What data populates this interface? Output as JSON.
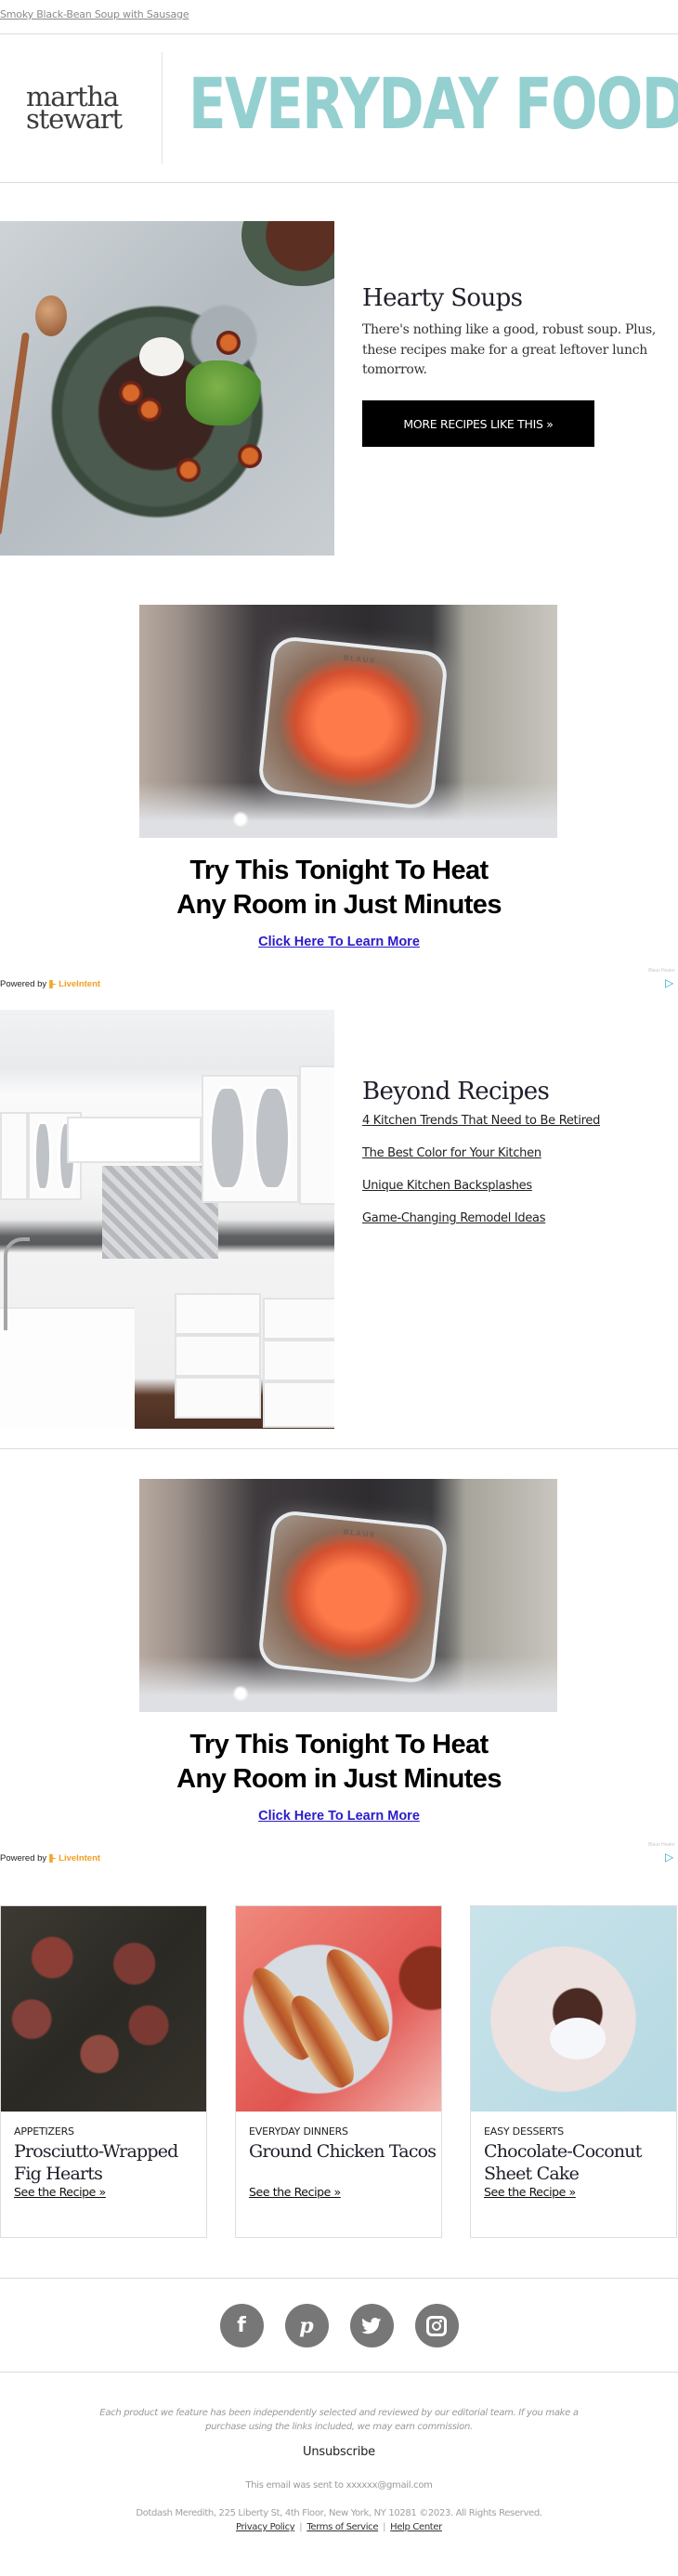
{
  "preheader": {
    "link_text": "Smoky Black-Bean Soup with Sausage"
  },
  "header": {
    "brand_line1": "martha",
    "brand_line2": "stewart",
    "publication": "EVERYDAY FOOD"
  },
  "hero": {
    "image_alt": "black bean soup bowl with sausage, sour cream and celery",
    "title": "Hearty Soups",
    "description": "There's nothing like a good, robust soup. Plus, these recipes make for a great leftover lunch tomorrow.",
    "button_label": "MORE RECIPES LIKE THIS »"
  },
  "ads": [
    {
      "image_alt": "Blaux portable heater glowing",
      "brand_on_product": "BLAUX",
      "headline_line1": "Try This Tonight To Heat",
      "headline_line2": "Any Room in Just Minutes",
      "cta": "Click Here To Learn More",
      "powered_by": "Powered by",
      "network": "LiveIntent",
      "adchoice_label": "Blaux Heater"
    },
    {
      "image_alt": "Blaux portable heater glowing",
      "brand_on_product": "BLAUX",
      "headline_line1": "Try This Tonight To Heat",
      "headline_line2": "Any Room in Just Minutes",
      "cta": "Click Here To Learn More",
      "powered_by": "Powered by",
      "network": "LiveIntent",
      "adchoice_label": "Blaux Heater"
    }
  ],
  "beyond": {
    "image_alt": "white kitchen with herringbone backsplash",
    "title": "Beyond Recipes",
    "links": [
      "4 Kitchen Trends That Need to Be Retired",
      "The Best Color for Your Kitchen",
      "Unique Kitchen Backsplashes",
      "Game-Changing Remodel Ideas"
    ]
  },
  "cards": [
    {
      "category": "APPETIZERS",
      "title": "Prosciutto-Wrapped Fig Hearts",
      "link": "See the Recipe »",
      "image_alt": "prosciutto wrapped figs on skewers"
    },
    {
      "category": "EVERYDAY DINNERS",
      "title": "Ground Chicken Tacos",
      "link": "See the Recipe »",
      "image_alt": "ground chicken tacos with lime and salsa"
    },
    {
      "category": "EASY DESSERTS",
      "title": "Chocolate-Coconut Sheet Cake",
      "link": "See the Recipe »",
      "image_alt": "chocolate coconut sheet cake with whipped cream"
    }
  ],
  "social": [
    {
      "name": "facebook",
      "glyph": "f"
    },
    {
      "name": "pinterest",
      "glyph": "p"
    },
    {
      "name": "twitter",
      "glyph": "🐦"
    },
    {
      "name": "instagram",
      "glyph": ""
    }
  ],
  "footer": {
    "disclaimer": "Each product we feature has been independently selected and reviewed by our editorial team. If you make a purchase using the links included, we may earn commission.",
    "unsubscribe": "Unsubscribe",
    "sent_to": "This email was sent to xxxxxx@gmail.com",
    "address": "Dotdash Meredith, 225 Liberty St, 4th Floor, New York, NY 10281 ©2023. All Rights Reserved.",
    "links": [
      "Privacy Policy",
      "Terms of Service",
      "Help Center"
    ],
    "separator": "|"
  },
  "colors": {
    "brand_teal": "#95d0d1",
    "ad_link": "#2a1cc9",
    "liveintent_orange": "#f1a020",
    "social_gray": "#777777"
  }
}
